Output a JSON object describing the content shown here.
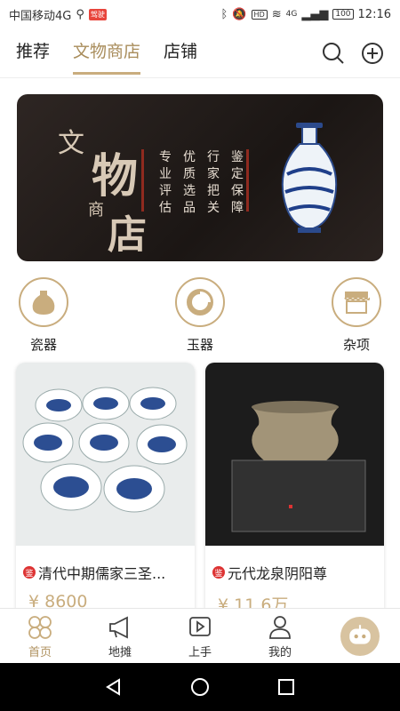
{
  "status": {
    "carrier": "中国移动4G",
    "badge": "驾驶",
    "hd": "HD",
    "network": "4G",
    "battery": "100",
    "time": "12:16"
  },
  "topnav": {
    "tabs": [
      {
        "label": "推荐"
      },
      {
        "label": "文物商店"
      },
      {
        "label": "店铺"
      }
    ]
  },
  "banner": {
    "brush_chars": [
      "文",
      "物",
      "商",
      "店"
    ],
    "slogans": [
      "专",
      "优",
      "行",
      "鉴",
      "业",
      "质",
      "家",
      "定",
      "评",
      "选",
      "把",
      "保",
      "估",
      "品",
      "关",
      "障"
    ]
  },
  "categories": [
    {
      "label": "瓷器"
    },
    {
      "label": "玉器"
    },
    {
      "label": "杂项"
    }
  ],
  "products": [
    {
      "tag": "鉴",
      "title": "清代中期儒家三圣...",
      "price": "¥ 8600"
    },
    {
      "tag": "鉴",
      "title": "元代龙泉阴阳尊",
      "price": "¥ 11.6万"
    }
  ],
  "bottomnav": {
    "items": [
      {
        "label": "首页"
      },
      {
        "label": "地摊"
      },
      {
        "label": "上手"
      },
      {
        "label": "我的"
      }
    ]
  },
  "colors": {
    "accent": "#c9ad7e",
    "active_text": "#a98d5c"
  }
}
